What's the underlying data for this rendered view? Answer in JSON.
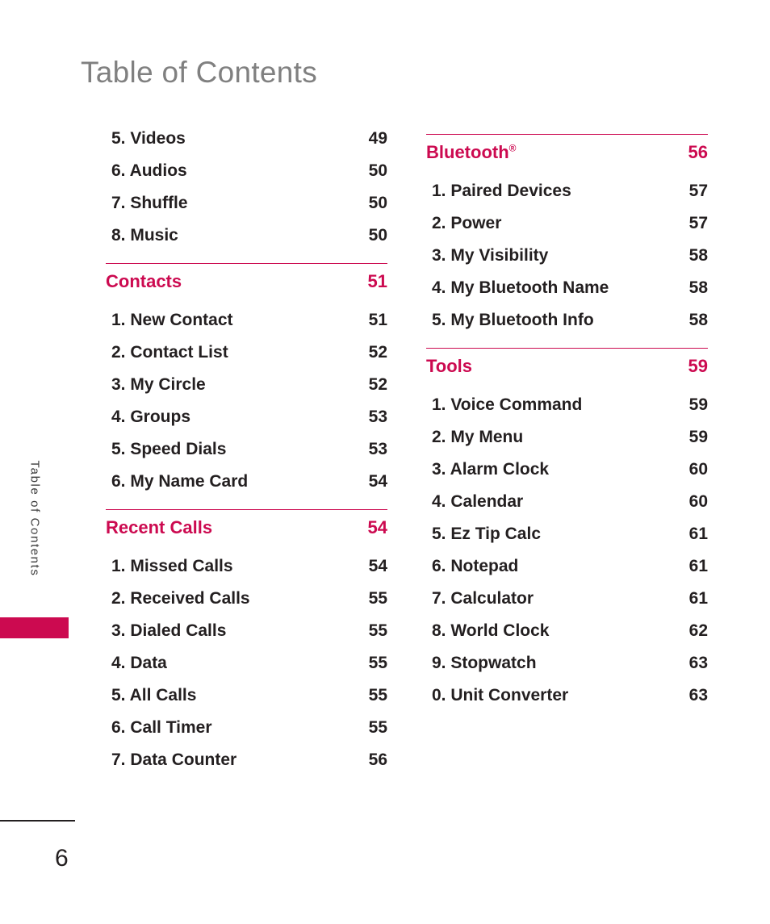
{
  "page": {
    "title": "Table of Contents",
    "side_tab_label": "Table of Contents",
    "page_number": "6",
    "accent_color": "#cc0a50",
    "title_color": "#808080",
    "text_color": "#231f20"
  },
  "columns": [
    {
      "name": "left",
      "blocks": [
        {
          "type": "items",
          "rows": [
            {
              "label": "5. Videos",
              "page": "49"
            },
            {
              "label": "6. Audios",
              "page": "50"
            },
            {
              "label": "7. Shuffle",
              "page": "50"
            },
            {
              "label": "8. Music",
              "page": "50"
            }
          ]
        },
        {
          "type": "section",
          "header": {
            "label": "Contacts",
            "page": "51"
          },
          "rows": [
            {
              "label": "1. New Contact",
              "page": "51"
            },
            {
              "label": "2. Contact List",
              "page": "52"
            },
            {
              "label": "3. My Circle",
              "page": "52"
            },
            {
              "label": "4. Groups",
              "page": "53"
            },
            {
              "label": "5. Speed Dials",
              "page": "53"
            },
            {
              "label": "6. My Name Card",
              "page": "54"
            }
          ]
        },
        {
          "type": "section",
          "header": {
            "label": "Recent Calls",
            "page": "54"
          },
          "rows": [
            {
              "label": "1. Missed Calls",
              "page": "54"
            },
            {
              "label": "2. Received Calls",
              "page": "55"
            },
            {
              "label": "3. Dialed Calls",
              "page": "55"
            },
            {
              "label": "4. Data",
              "page": "55"
            },
            {
              "label": "5. All Calls",
              "page": "55"
            },
            {
              "label": "6. Call Timer",
              "page": "55"
            },
            {
              "label": "7. Data Counter",
              "page": "56"
            }
          ]
        }
      ]
    },
    {
      "name": "right",
      "blocks": [
        {
          "type": "section",
          "header": {
            "label": "Bluetooth",
            "label_sup": "®",
            "page": "56"
          },
          "rows": [
            {
              "label": "1. Paired Devices",
              "page": "57"
            },
            {
              "label": "2. Power",
              "page": "57"
            },
            {
              "label": "3. My Visibility",
              "page": "58"
            },
            {
              "label": "4. My Bluetooth Name",
              "page": "58"
            },
            {
              "label": "5. My Bluetooth Info",
              "page": "58"
            }
          ]
        },
        {
          "type": "section",
          "header": {
            "label": "Tools",
            "page": "59"
          },
          "rows": [
            {
              "label": "1. Voice Command",
              "page": "59"
            },
            {
              "label": "2. My Menu",
              "page": "59"
            },
            {
              "label": "3. Alarm Clock",
              "page": "60"
            },
            {
              "label": "4. Calendar",
              "page": "60"
            },
            {
              "label": "5. Ez Tip Calc",
              "page": "61"
            },
            {
              "label": "6. Notepad",
              "page": "61"
            },
            {
              "label": "7. Calculator",
              "page": "61"
            },
            {
              "label": "8. World Clock",
              "page": "62"
            },
            {
              "label": "9. Stopwatch",
              "page": "63"
            },
            {
              "label": "0. Unit Converter",
              "page": "63"
            }
          ]
        }
      ]
    }
  ]
}
